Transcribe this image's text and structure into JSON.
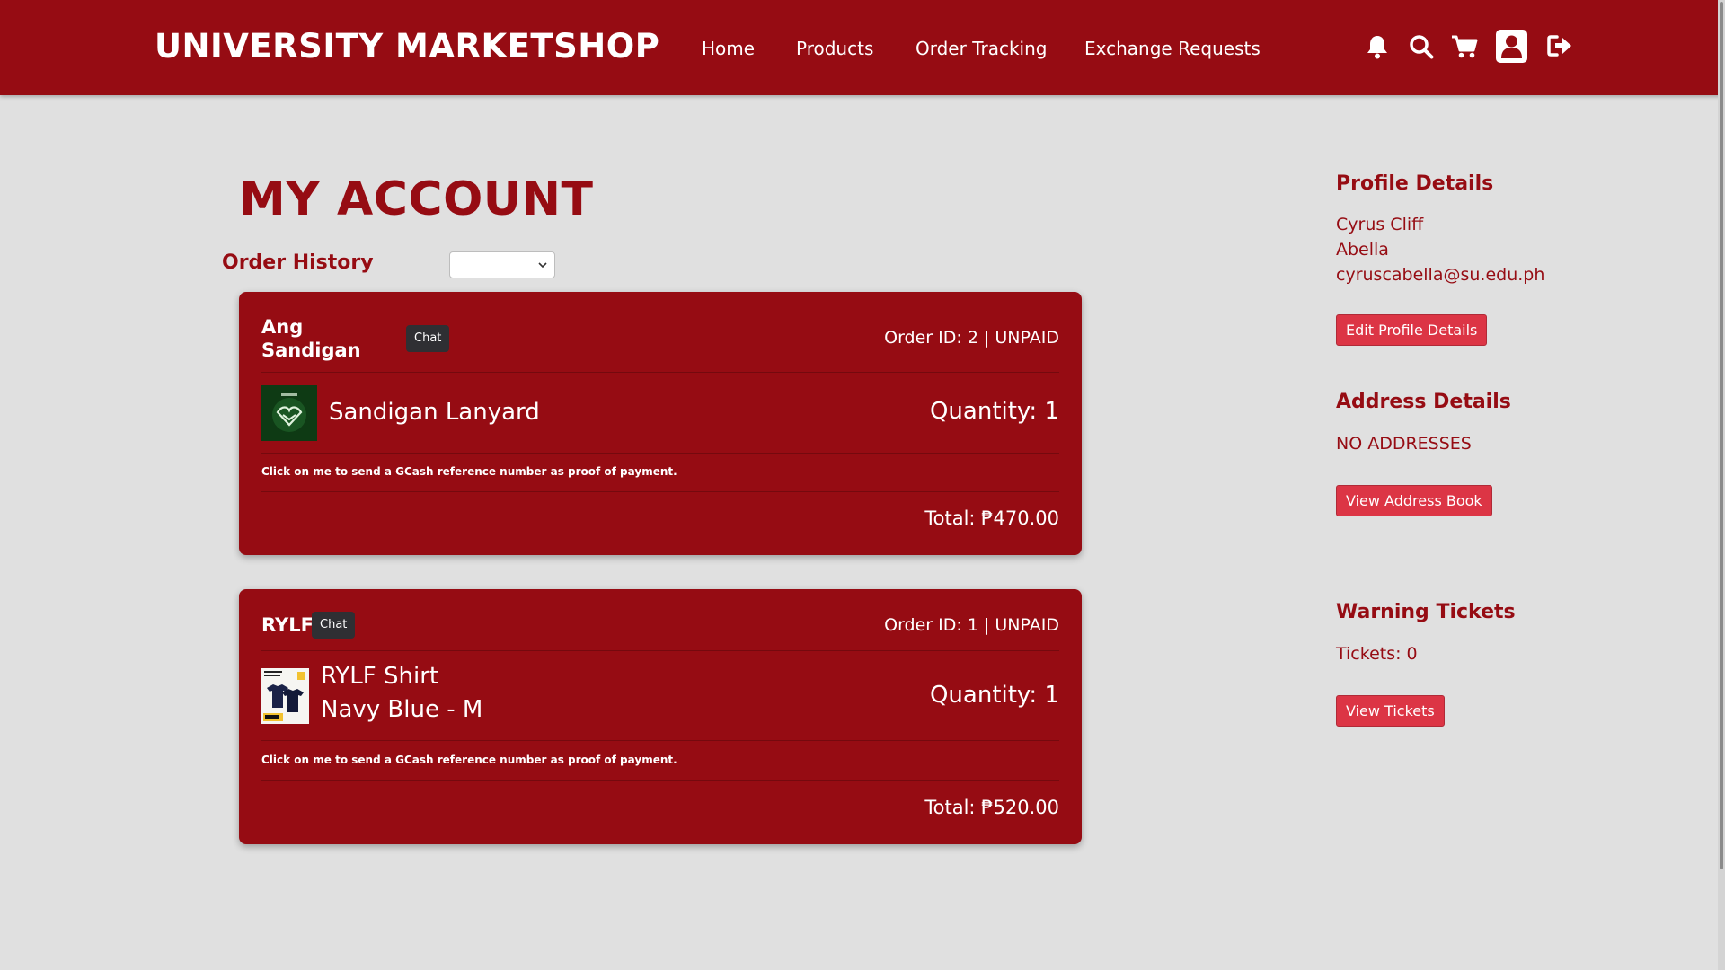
{
  "header": {
    "brand": "UNIVERSITY MARKETSHOP",
    "nav": [
      "Home",
      "Products",
      "Order Tracking",
      "Exchange Requests"
    ],
    "icons": [
      "bell-icon",
      "search-icon",
      "cart-icon",
      "user-icon",
      "logout-icon"
    ]
  },
  "main": {
    "title": "MY ACCOUNT",
    "order_history_label": "Order History",
    "filter_value": "",
    "orders": [
      {
        "shop": "Ang Sandigan",
        "chat_label": "Chat",
        "meta": "Order ID: 2 | UNPAID",
        "product_name": "Sandigan Lanyard",
        "product_variant": "",
        "quantity": "Quantity: 1",
        "hint": "Click on me to send a GCash reference number as proof of payment.",
        "total": "Total: ₱470.00"
      },
      {
        "shop": "RYLF",
        "chat_label": "Chat",
        "meta": "Order ID: 1 | UNPAID",
        "product_name": "RYLF Shirt",
        "product_variant": "Navy Blue - M",
        "quantity": "Quantity: 1",
        "hint": "Click on me to send a GCash reference number as proof of payment.",
        "total": "Total: ₱520.00"
      }
    ]
  },
  "sidebar": {
    "profile": {
      "heading": "Profile Details",
      "first_name": "Cyrus Cliff",
      "last_name": "Abella",
      "email": "cyruscabella@su.edu.ph",
      "button": "Edit Profile Details"
    },
    "address": {
      "heading": "Address Details",
      "text": "NO ADDRESSES",
      "button": "View Address Book"
    },
    "tickets": {
      "heading": "Warning Tickets",
      "text": "Tickets: 0",
      "button": "View Tickets"
    }
  },
  "colors": {
    "brand_red": "#960c13",
    "button_red": "#dc3545",
    "chat_dark": "#2f2f33",
    "page_bg": "#e0e0e0"
  }
}
